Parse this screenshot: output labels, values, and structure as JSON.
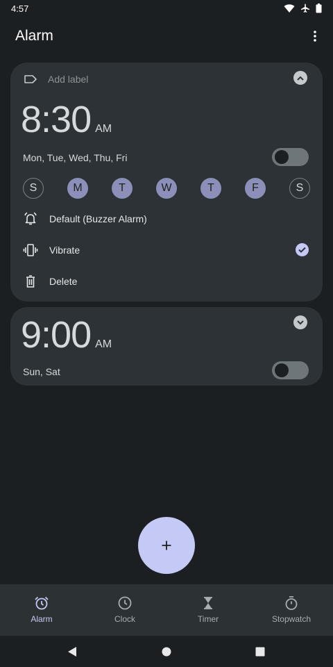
{
  "status_bar": {
    "time": "4:57"
  },
  "app_bar": {
    "title": "Alarm"
  },
  "alarms": [
    {
      "label_placeholder": "Add label",
      "time": "8:30",
      "ampm": "AM",
      "days_summary": "Mon, Tue, Wed, Thu, Fri",
      "enabled": false,
      "expanded": true,
      "days": [
        {
          "letter": "S",
          "selected": false
        },
        {
          "letter": "M",
          "selected": true
        },
        {
          "letter": "T",
          "selected": true
        },
        {
          "letter": "W",
          "selected": true
        },
        {
          "letter": "T",
          "selected": true
        },
        {
          "letter": "F",
          "selected": true
        },
        {
          "letter": "S",
          "selected": false
        }
      ],
      "ringtone": "Default (Buzzer Alarm)",
      "vibrate_label": "Vibrate",
      "vibrate_checked": true,
      "delete_label": "Delete"
    },
    {
      "time": "9:00",
      "ampm": "AM",
      "days_summary": "Sun, Sat",
      "enabled": false,
      "expanded": false
    }
  ],
  "fab": {
    "icon": "plus-icon"
  },
  "bottom_nav": [
    {
      "label": "Alarm",
      "icon": "alarm-icon",
      "active": true
    },
    {
      "label": "Clock",
      "icon": "clock-icon",
      "active": false
    },
    {
      "label": "Timer",
      "icon": "hourglass-icon",
      "active": false
    },
    {
      "label": "Stopwatch",
      "icon": "stopwatch-icon",
      "active": false
    }
  ],
  "colors": {
    "background": "#1c1f21",
    "card": "#2c3235",
    "accent": "#c4c9f5",
    "day_selected": "#8c90b8"
  }
}
